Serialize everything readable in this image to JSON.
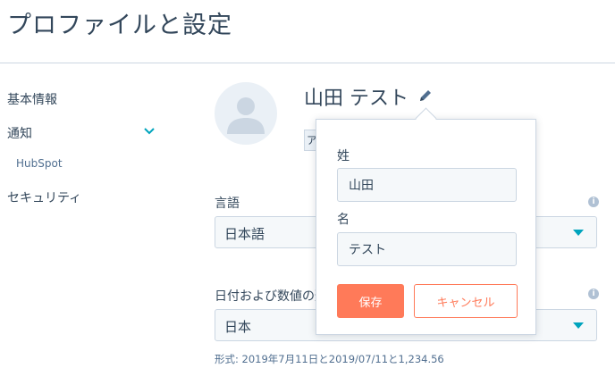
{
  "page": {
    "title": "プロファイルと設定"
  },
  "sidebar": {
    "items": [
      {
        "label": "基本情報"
      },
      {
        "label": "通知"
      },
      {
        "label": "HubSpot"
      },
      {
        "label": "セキュリティ"
      }
    ]
  },
  "profile": {
    "name": "山田 テスト",
    "badge_text": "ア"
  },
  "language": {
    "label": "言語",
    "value": "日本語"
  },
  "date_format": {
    "label": "日付および数値の形",
    "value": "日本",
    "format_text": "形式: 2019年7月11日と2019/07/11と1,234.56"
  },
  "name_popover": {
    "last_name_label": "姓",
    "last_name_value": "山田",
    "first_name_label": "名",
    "first_name_value": "テスト",
    "save_label": "保存",
    "cancel_label": "キャンセル"
  },
  "colors": {
    "accent": "#ff7a59",
    "caret": "#00a4bd",
    "text": "#33475b",
    "border": "#cbd6e2"
  },
  "icons": {
    "edit": "pencil-icon",
    "chevron": "chevron-down-icon",
    "info": "info-icon",
    "avatar": "user-avatar-icon"
  }
}
